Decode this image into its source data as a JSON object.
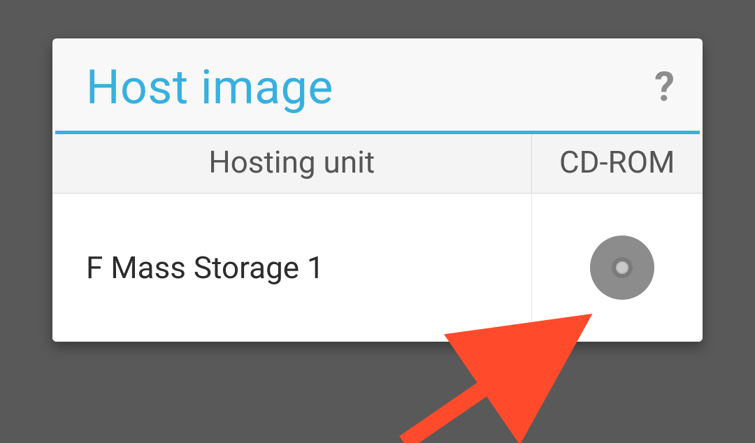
{
  "dialog": {
    "title": "Host image",
    "help_icon": "?"
  },
  "table": {
    "columns": {
      "hosting_unit": "Hosting unit",
      "cd_rom": "CD-ROM"
    },
    "row": {
      "hosting_unit": "F Mass Storage 1"
    }
  },
  "colors": {
    "accent": "#37b0df"
  }
}
